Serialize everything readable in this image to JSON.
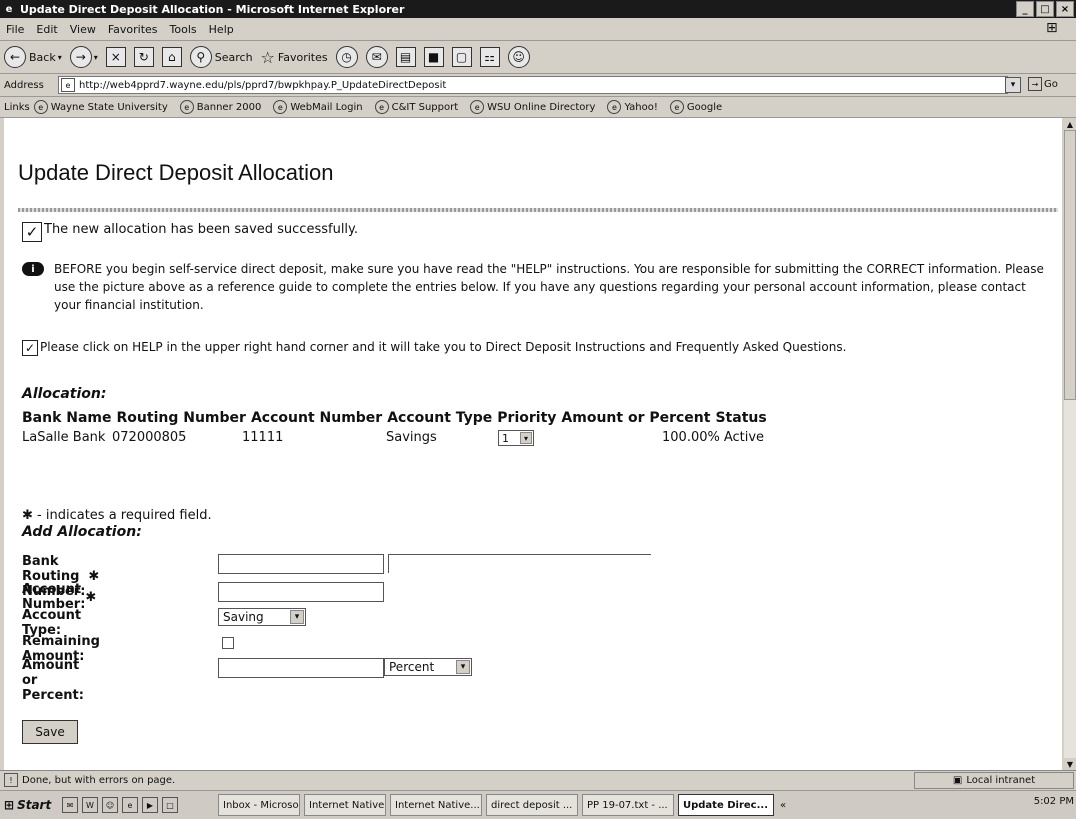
{
  "window": {
    "title": "Update Direct Deposit Allocation - Microsoft Internet Explorer"
  },
  "menu": [
    "File",
    "Edit",
    "View",
    "Favorites",
    "Tools",
    "Help"
  ],
  "toolbar": {
    "back_label": "Back",
    "search_label": "Search",
    "favorites_label": "Favorites"
  },
  "address": {
    "label": "Address",
    "url": "http://web4pprd7.wayne.edu/pls/pprd7/bwpkhpay.P_UpdateDirectDeposit",
    "go_label": "Go"
  },
  "links": {
    "label": "Links",
    "items": [
      "Wayne State University",
      "Banner 2000",
      "WebMail Login",
      "C&IT Support",
      "WSU Online Directory",
      "Yahoo!",
      "Google"
    ]
  },
  "page": {
    "title": "Update Direct Deposit Allocation",
    "success_message": "The new allocation has been saved successfully.",
    "info_note": "BEFORE you begin self-service direct deposit, make sure you have read the \"HELP\" instructions. You are responsible for submitting the CORRECT information. Please use the picture above as a reference guide to complete the entries below. If you have any questions regarding your personal account information, please contact your financial institution.",
    "help_message": "Please click on HELP in the upper right hand corner and it will take you to Direct Deposit Instructions and Frequently Asked Questions.",
    "allocation_heading": "Allocation:",
    "table": {
      "headers": [
        "Bank Name",
        "Routing Number",
        "Account Number",
        "Account Type",
        "Priority",
        "Amount or Percent",
        "Status"
      ],
      "rows": [
        {
          "bank_name": "LaSalle Bank",
          "routing": "072000805",
          "account": "11111",
          "type": "Savings",
          "priority": "1",
          "amount": "100.00%",
          "status": "Active"
        }
      ]
    },
    "required_note": "- indicates a required field.",
    "add_heading": "Add Allocation:",
    "form": {
      "routing_label": "Bank Routing Number:",
      "account_label": "Account Number:",
      "type_label": "Account Type:",
      "type_value": "Saving",
      "remaining_label": "Remaining Amount:",
      "amount_label": "Amount or Percent:",
      "amount_unit": "Percent",
      "required_mark": "✱"
    },
    "save_label": "Save"
  },
  "status": {
    "text": "Done, but with errors on page.",
    "zone": "Local intranet"
  },
  "taskbar": {
    "start": "Start",
    "tasks": [
      "Inbox - Microso...",
      "Internet Native...",
      "Internet Native...",
      "direct deposit ...",
      "PP 19-07.txt - ...",
      "Update Direc..."
    ],
    "clock": "5:02 PM",
    "chevron": "«"
  }
}
